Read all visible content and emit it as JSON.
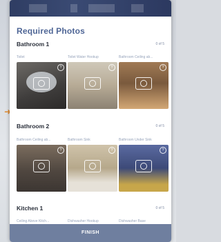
{
  "sheet_title": "Required Photos",
  "sections": [
    {
      "title": "Bathroom 1",
      "count": "0 of 5",
      "cells": [
        "Toilet",
        "Toilet Water Hookup",
        "Bathroom Ceiling ab..."
      ]
    },
    {
      "title": "Bathroom 2",
      "count": "0 of 5",
      "cells": [
        "Bathroom Ceiling ab...",
        "Bathroom Sink",
        "Bathroom Under Sink"
      ]
    },
    {
      "title": "Kitchen 1",
      "count": "0 of 5",
      "cells": [
        "Ceiling Above Kitch...",
        "Dishwasher Hookup",
        "Dishwasher Base"
      ]
    }
  ],
  "help_glyph": "?",
  "finish_label": "FINISH",
  "colors": {
    "title": "#4f6696",
    "finish_bar": "#6f7f9f",
    "topbar": "#2f3d63"
  },
  "icons": [
    "camera-icon",
    "help-icon",
    "arrow-marker-icon"
  ]
}
